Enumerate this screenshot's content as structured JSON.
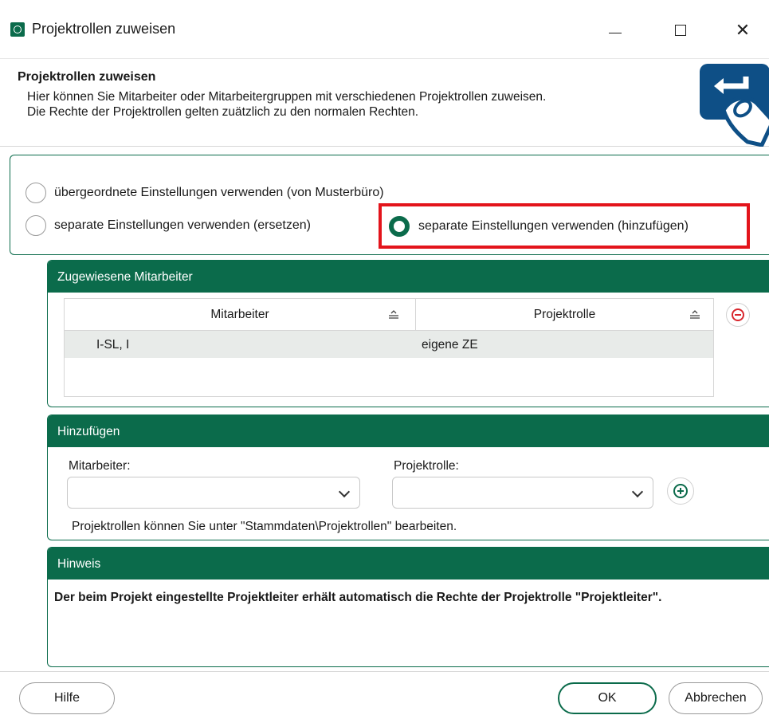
{
  "window": {
    "title": "Projektrollen zuweisen"
  },
  "header": {
    "title": "Projektrollen zuweisen",
    "description": "Hier können Sie Mitarbeiter oder Mitarbeitergruppen mit verschiedenen Projektrollen zuweisen. Die Rechte der Projektrollen gelten zuätzlich zu den normalen Rechten."
  },
  "options": {
    "inherit": {
      "label": "übergeordnete Einstellungen verwenden (von Musterbüro)",
      "checked": false
    },
    "replace": {
      "label": "separate Einstellungen verwenden (ersetzen)",
      "checked": false
    },
    "add": {
      "label": "separate Einstellungen verwenden (hinzufügen)",
      "checked": true
    }
  },
  "assigned": {
    "title": "Zugewiesene Mitarbeiter",
    "columns": [
      "Mitarbeiter",
      "Projektrolle"
    ],
    "rows": [
      {
        "mitarbeiter": "I-SL, I",
        "projektrolle": "eigene ZE"
      }
    ]
  },
  "add_section": {
    "title": "Hinzufügen",
    "employee_label": "Mitarbeiter:",
    "role_label": "Projektrolle:",
    "hint": "Projektrollen können Sie unter \"Stammdaten\\Projektrollen\" bearbeiten."
  },
  "note": {
    "title": "Hinweis",
    "text": "Der beim Projekt eingestellte Projektleiter erhält automatisch die Rechte der Projektrolle \"Projektleiter\"."
  },
  "footer": {
    "help": "Hilfe",
    "ok": "OK",
    "cancel": "Abbrechen"
  },
  "colors": {
    "accent": "#0b6b4b",
    "highlight": "#e3141b"
  }
}
